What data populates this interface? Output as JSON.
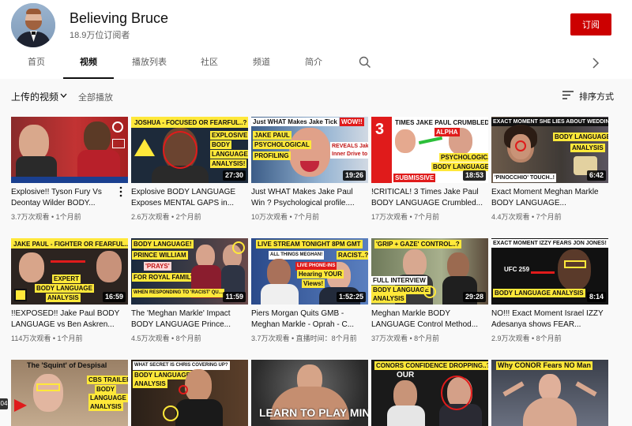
{
  "channel": {
    "name": "Believing Bruce",
    "subscribers": "18.9万位订阅者",
    "subscribe_label": "订阅"
  },
  "tabs": [
    {
      "label": "首页"
    },
    {
      "label": "视频"
    },
    {
      "label": "播放列表"
    },
    {
      "label": "社区"
    },
    {
      "label": "频道"
    },
    {
      "label": "简介"
    }
  ],
  "icons": {
    "search": "search-icon",
    "next": "chevron-right-icon",
    "sort": "sort-icon",
    "caret": "chevron-down-icon",
    "more": "more-vert-icon"
  },
  "filter": {
    "uploads_label": "上传的视频",
    "play_all": "全部播放",
    "sort_label": "排序方式"
  },
  "colors": {
    "subscribe": "#cc0000",
    "caption_yellow": "#ffe83a",
    "caption_red": "#e01b1b"
  },
  "videos": [
    {
      "title": "Explosive!! Tyson Fury Vs Deontay Wilder BODY...",
      "views": "3.7万次观看",
      "age": "1个月前",
      "duration": "",
      "captions": []
    },
    {
      "title": "Explosive BODY LANGUAGE Exposes MENTAL GAPS in...",
      "views": "2.6万次观看",
      "age": "2个月前",
      "duration": "27:30",
      "captions": [
        "JOSHUA - FOCUSED OR FEARFUL..?",
        "EXPLOSIVE",
        "BODY",
        "LANGUAGE",
        "ANALYSIS!"
      ]
    },
    {
      "title": "Just WHAT Makes Jake Paul Win ? Psychological profile....",
      "views": "10万次观看",
      "age": "7个月前",
      "duration": "19:26",
      "captions": [
        "Just WHAT Makes Jake Tick",
        "WOW!!",
        "JAKE PAUL",
        "PSYCHOLOGICAL",
        "PROFILING",
        "REVEALS Jake's",
        "Inner Drive to"
      ]
    },
    {
      "title": "!CRITICAL! 3 Times Jake Paul BODY LANGUAGE Crumbled...",
      "views": "17万次观看",
      "age": "7个月前",
      "duration": "18:53",
      "captions": [
        "3",
        "TIMES JAKE PAUL CRUMBLED..?",
        "ALPHA",
        "PSYCHOLOGICAL",
        "BODY LANGUAGE",
        "SUBMISSIVE"
      ]
    },
    {
      "title": "Exact Moment Meghan Markle BODY LANGUAGE...",
      "views": "4.4万次观看",
      "age": "7个月前",
      "duration": "6:42",
      "captions": [
        "EXACT MOMENT SHE LIES ABOUT WEDDING!",
        "BODY LANGUAGE",
        "ANALYSIS",
        "'PINOCCHIO' TOUCH..!"
      ]
    },
    {
      "title": "!!EXPOSED!! Jake Paul BODY LANGUAGE vs Ben Askren...",
      "views": "114万次观看",
      "age": "1个月前",
      "duration": "16:59",
      "captions": [
        "JAKE PAUL - FIGHTER OR FEARFUL..?",
        "EXPERT",
        "BODY LANGUAGE",
        "ANALYSIS"
      ]
    },
    {
      "title": "The 'Meghan Markle' Impact BODY LANGUAGE Prince...",
      "views": "4.5万次观看",
      "age": "8个月前",
      "duration": "11:59",
      "captions": [
        "BODY LANGUAGE!",
        "PRINCE WILLIAM",
        "'PRAYS'",
        "FOR ROYAL FAMILY",
        "WHEN RESPONDING TO 'RACIST' QU..."
      ]
    },
    {
      "title": "Piers Morgan Quits GMB - Meghan Markle - Oprah - C...",
      "views": "3.7万次观看",
      "age": "直播时间：8个月前",
      "duration": "1:52:25",
      "captions": [
        "LIVE STREAM TONIGHT 8PM GMT",
        "RACIST..?",
        "ALL THINGS MEGHAN!",
        "LIVE PHONE-INS",
        "Hearing YOUR",
        "Views!"
      ]
    },
    {
      "title": "Meghan Markle BODY LANGUAGE Control Method...",
      "views": "37万次观看",
      "age": "8个月前",
      "duration": "29:28",
      "captions": [
        "'GRIP + GAZE' CONTROL..?",
        "FULL INTERVIEW",
        "BODY LANGUAGE",
        "ANALYSIS"
      ]
    },
    {
      "title": "NO!!! Exact Moment Israel IZZY Adesanya shows FEAR...",
      "views": "2.9万次观看",
      "age": "8个月前",
      "duration": "8:14",
      "captions": [
        "EXACT MOMENT IZZY FEARS JON JONES!",
        "UFC 259",
        "BODY LANGUAGE ANALYSIS"
      ]
    },
    {
      "title": "",
      "views": "",
      "age": "",
      "duration": "",
      "captions": [
        "The 'Squint' of Despisal",
        "CBS TRAILER",
        "BODY",
        "LANGUAGE",
        "ANALYSIS"
      ]
    },
    {
      "title": "",
      "views": "",
      "age": "",
      "duration": "",
      "captions": [
        "WHAT SECRET IS CHRIS COVERING UP?",
        "BODY LANGUAGE",
        "ANALYSIS"
      ]
    },
    {
      "title": "",
      "views": "",
      "age": "",
      "duration": "",
      "captions": [
        "LEARN TO PLAY MIND"
      ]
    },
    {
      "title": "",
      "views": "",
      "age": "",
      "duration": "",
      "captions": [
        "CONORS CONFIDENCE DROPPING..?",
        "OUR"
      ]
    },
    {
      "title": "",
      "views": "",
      "age": "",
      "duration": "",
      "captions": [
        "Why CONOR Fears NO Man"
      ]
    }
  ],
  "edge_badge": "04"
}
